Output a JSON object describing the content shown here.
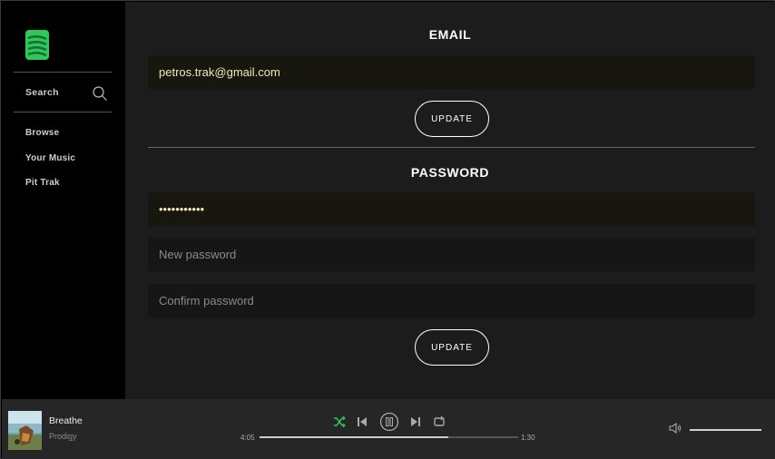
{
  "sidebar": {
    "search_label": "Search",
    "nav_items": [
      "Browse",
      "Your Music",
      "Pit Trak"
    ]
  },
  "email_section": {
    "title": "EMAIL",
    "value": "petros.trak@gmail.com",
    "button_label": "UPDATE"
  },
  "password_section": {
    "title": "PASSWORD",
    "current_value": "•••••••••••",
    "new_placeholder": "New password",
    "confirm_placeholder": "Confirm password",
    "button_label": "UPDATE"
  },
  "player": {
    "track_title": "Breathe",
    "artist": "Prodigy",
    "elapsed": "4:05",
    "remaining": "1:30",
    "progress_fraction": 0.73,
    "volume_fraction": 1.0,
    "shuffle_active": true
  },
  "colors": {
    "accent": "#2ec95a",
    "main_bg": "#1c1c1c",
    "sidebar_bg": "#000000",
    "player_bg": "#262626",
    "field_text": "#f4e8b4"
  },
  "icons": [
    "logo-icon",
    "search-icon",
    "shuffle-icon",
    "previous-icon",
    "pause-icon",
    "next-icon",
    "repeat-icon",
    "volume-icon"
  ]
}
